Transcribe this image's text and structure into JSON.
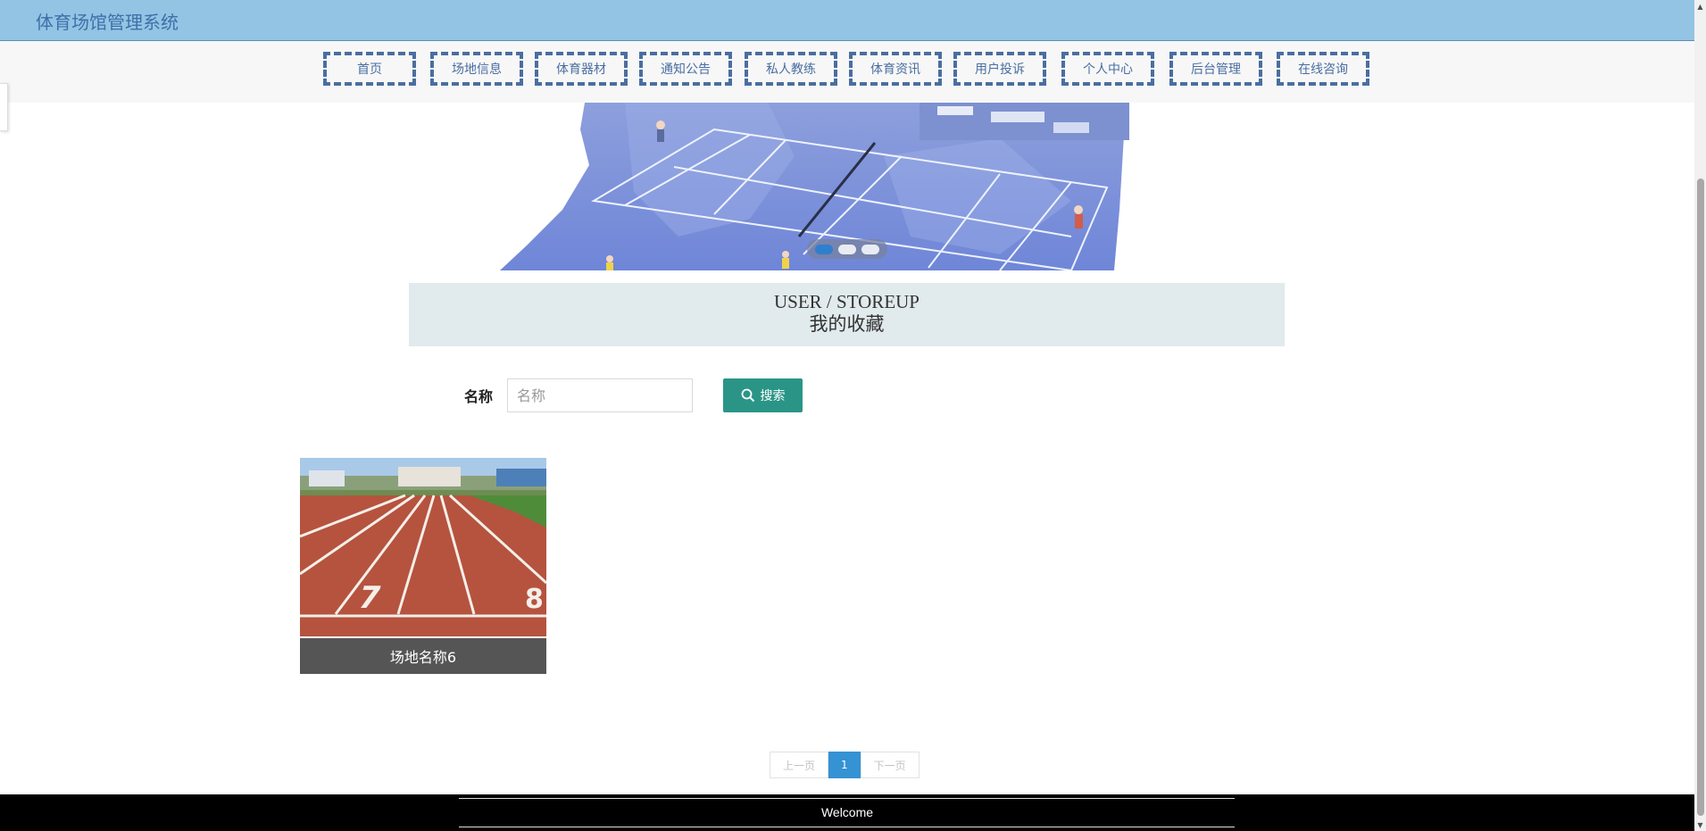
{
  "header": {
    "brand": "体育场馆管理系统"
  },
  "nav": {
    "items": [
      "首页",
      "场地信息",
      "体育器材",
      "通知公告",
      "私人教练",
      "体育资讯",
      "用户投诉",
      "个人中心",
      "后台管理",
      "在线咨询"
    ]
  },
  "banner": {
    "slides": 3,
    "active_slide": 1
  },
  "section": {
    "title_en": "USER / STOREUP",
    "title_cn": "我的收藏"
  },
  "search": {
    "label": "名称",
    "placeholder": "名称",
    "value": "",
    "button_label": "搜索"
  },
  "cards": [
    {
      "caption": "场地名称6"
    }
  ],
  "pagination": {
    "prev": "上一页",
    "current": "1",
    "next": "下一页"
  },
  "footer": {
    "text": "Welcome"
  },
  "colors": {
    "header_bg": "#93c4e4",
    "nav_border": "#4a6ea0",
    "search_btn": "#2a9586",
    "page_active": "#3592d3"
  }
}
